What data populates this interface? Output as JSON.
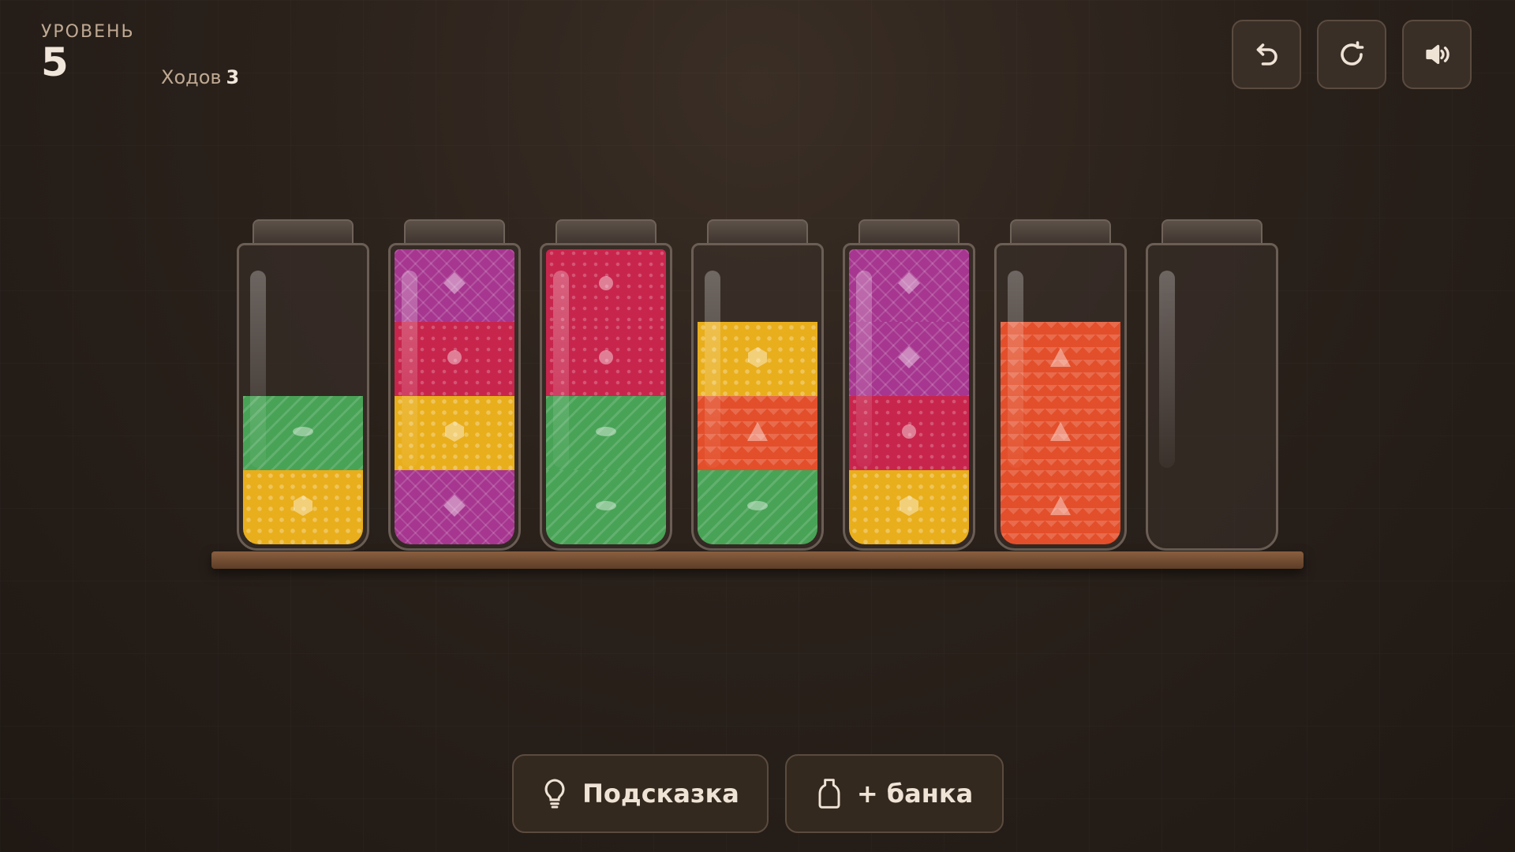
{
  "header": {
    "level_label": "УРОВЕНЬ",
    "level_number": "5",
    "moves_label": "Ходов",
    "moves_count": "3"
  },
  "toolbar": [
    {
      "name": "undo-button",
      "icon": "undo-icon"
    },
    {
      "name": "restart-button",
      "icon": "restart-icon"
    },
    {
      "name": "sound-button",
      "icon": "sound-icon"
    }
  ],
  "colors": {
    "green": "#48a356",
    "yellow": "#e9ae1c",
    "crimson": "#c8254d",
    "purple": "#a6368f",
    "orange": "#e34f2b"
  },
  "symbols": {
    "green": "ellipse",
    "yellow": "hexagon",
    "crimson": "circle",
    "purple": "diamond",
    "orange": "triangle"
  },
  "jars": [
    {
      "layers_bottom_to_top": [
        "yellow",
        "green"
      ]
    },
    {
      "layers_bottom_to_top": [
        "purple",
        "yellow",
        "crimson",
        "purple"
      ]
    },
    {
      "layers_bottom_to_top": [
        "green",
        "green",
        "crimson",
        "crimson"
      ]
    },
    {
      "layers_bottom_to_top": [
        "green",
        "orange",
        "yellow"
      ]
    },
    {
      "layers_bottom_to_top": [
        "yellow",
        "crimson",
        "purple",
        "purple"
      ]
    },
    {
      "layers_bottom_to_top": [
        "orange",
        "orange",
        "orange"
      ]
    },
    {
      "layers_bottom_to_top": []
    }
  ],
  "jar_capacity": 4,
  "actions": {
    "hint_label": "Подсказка",
    "add_jar_label": "+ банка"
  }
}
